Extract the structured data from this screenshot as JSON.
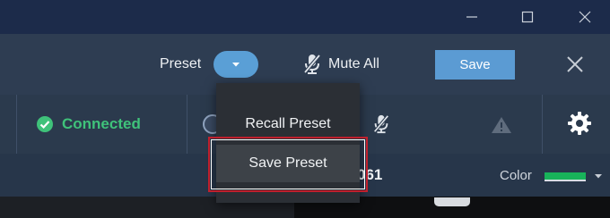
{
  "toolbar": {
    "preset_label": "Preset",
    "mute_all_label": "Mute All",
    "save_label": "Save"
  },
  "status": {
    "connected_label": "Connected"
  },
  "channel": {
    "name_fragment": "061",
    "color_label": "Color",
    "color_value": "#18b35a"
  },
  "preset_menu": {
    "items": [
      {
        "label": "Recall Preset"
      },
      {
        "label": "Save Preset"
      }
    ],
    "highlighted_index": 1
  },
  "colors": {
    "accent": "#5b9bd3",
    "connected": "#3fc27a",
    "highlight_border": "#c0202d"
  }
}
